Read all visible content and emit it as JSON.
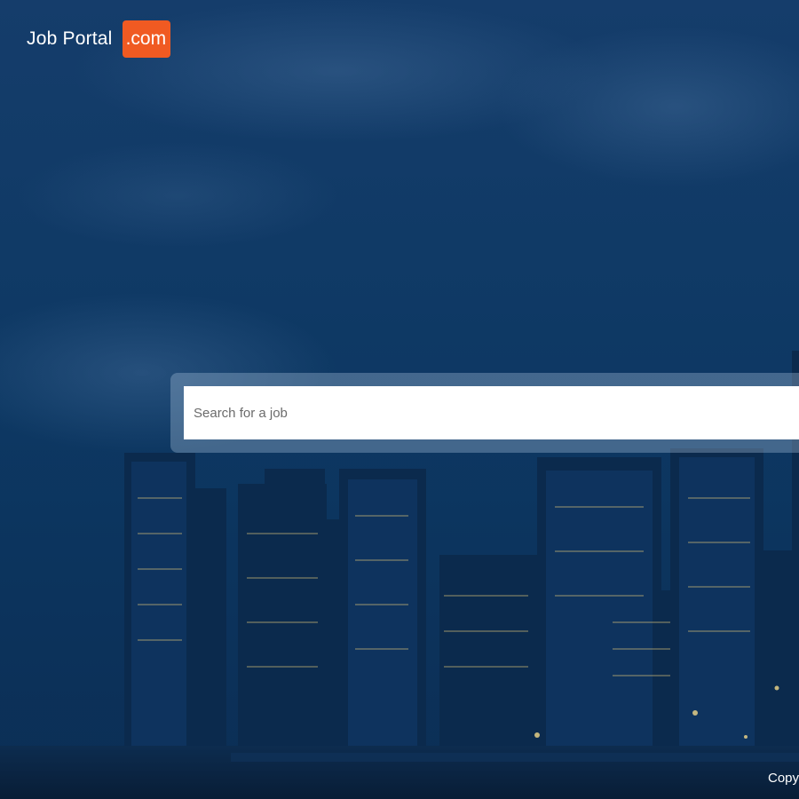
{
  "header": {
    "logo_text": "Job Portal",
    "logo_badge": ".com"
  },
  "search": {
    "placeholder": "Search for a job",
    "value": ""
  },
  "footer": {
    "text": "Copy"
  },
  "colors": {
    "background": "#0c3660",
    "badge": "#f05a22",
    "text": "#ffffff"
  }
}
